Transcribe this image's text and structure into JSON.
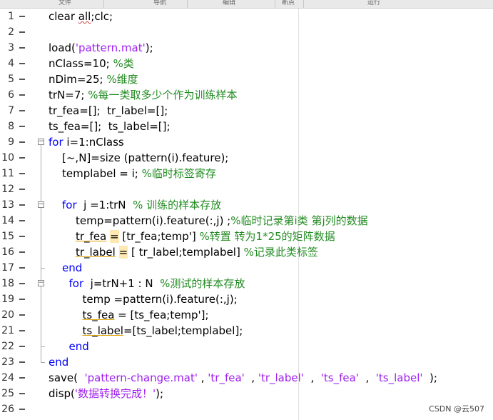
{
  "toolbar": {
    "sections": [
      "文件",
      "导航",
      "编辑",
      "断点",
      "运行"
    ]
  },
  "editor": {
    "lines": [
      {
        "n": "1",
        "indent": 0,
        "tokens": [
          {
            "t": "clear ",
            "c": ""
          },
          {
            "t": "all",
            "c": "squig"
          },
          {
            "t": ";clc;",
            "c": ""
          }
        ]
      },
      {
        "n": "2",
        "indent": 0,
        "tokens": []
      },
      {
        "n": "3",
        "indent": 0,
        "tokens": [
          {
            "t": "load(",
            "c": ""
          },
          {
            "t": "'pattern.mat'",
            "c": "str"
          },
          {
            "t": ");",
            "c": ""
          }
        ]
      },
      {
        "n": "4",
        "indent": 0,
        "tokens": [
          {
            "t": "nClass=10; ",
            "c": ""
          },
          {
            "t": "%类",
            "c": "cm"
          }
        ]
      },
      {
        "n": "5",
        "indent": 0,
        "tokens": [
          {
            "t": "nDim=25; ",
            "c": ""
          },
          {
            "t": "%维度",
            "c": "cm"
          }
        ]
      },
      {
        "n": "6",
        "indent": 0,
        "tokens": [
          {
            "t": "trN=7; ",
            "c": ""
          },
          {
            "t": "%每一类取多少个作为训练样本",
            "c": "cm"
          }
        ]
      },
      {
        "n": "7",
        "indent": 0,
        "tokens": [
          {
            "t": "tr_fea=[];  tr_label=[];",
            "c": ""
          }
        ]
      },
      {
        "n": "8",
        "indent": 0,
        "tokens": [
          {
            "t": "ts_fea=[];  ts_label=[];",
            "c": ""
          }
        ]
      },
      {
        "n": "9",
        "indent": 0,
        "tokens": [
          {
            "t": "for",
            "c": "kw"
          },
          {
            "t": " i=1:nClass",
            "c": ""
          }
        ]
      },
      {
        "n": "10",
        "indent": 1,
        "tokens": [
          {
            "t": "[~,N]=size (pattern(i).feature);",
            "c": ""
          }
        ]
      },
      {
        "n": "11",
        "indent": 1,
        "tokens": [
          {
            "t": "templabel = i; ",
            "c": ""
          },
          {
            "t": "%临时标签寄存",
            "c": "cm"
          }
        ]
      },
      {
        "n": "12",
        "indent": 1,
        "tokens": []
      },
      {
        "n": "13",
        "indent": 1,
        "tokens": [
          {
            "t": "for",
            "c": "kw"
          },
          {
            "t": "  j =1:trN  ",
            "c": ""
          },
          {
            "t": "% 训练的样本存放",
            "c": "cm"
          }
        ]
      },
      {
        "n": "14",
        "indent": 2,
        "tokens": [
          {
            "t": "temp=pattern(i).feature(:,j) ;",
            "c": ""
          },
          {
            "t": "%临时记录第i类 第j列的数据",
            "c": "cm"
          }
        ]
      },
      {
        "n": "15",
        "indent": 2,
        "tokens": [
          {
            "t": "tr_fea",
            "c": "warn"
          },
          {
            "t": " ",
            "c": ""
          },
          {
            "t": "=",
            "c": "hl"
          },
          {
            "t": " [tr_fea;temp'] ",
            "c": ""
          },
          {
            "t": "%转置 转为1*25的矩阵数据",
            "c": "cm"
          }
        ]
      },
      {
        "n": "16",
        "indent": 2,
        "tokens": [
          {
            "t": "tr_label",
            "c": "warn"
          },
          {
            "t": " ",
            "c": ""
          },
          {
            "t": "=",
            "c": "hl"
          },
          {
            "t": " [ tr_label;templabel] ",
            "c": ""
          },
          {
            "t": "%记录此类标签",
            "c": "cm"
          }
        ]
      },
      {
        "n": "17",
        "indent": 1,
        "tokens": [
          {
            "t": "end",
            "c": "kw"
          }
        ]
      },
      {
        "n": "18",
        "indent": 1.5,
        "tokens": [
          {
            "t": "for",
            "c": "kw"
          },
          {
            "t": "  j=trN+1 : N  ",
            "c": ""
          },
          {
            "t": "%测试的样本存放",
            "c": "cm"
          }
        ]
      },
      {
        "n": "19",
        "indent": 2.5,
        "tokens": [
          {
            "t": "temp =pattern(i).feature(:,j);",
            "c": ""
          }
        ]
      },
      {
        "n": "20",
        "indent": 2.5,
        "tokens": [
          {
            "t": "ts_fea",
            "c": "warn"
          },
          {
            "t": " = [ts_fea;temp'];",
            "c": ""
          }
        ]
      },
      {
        "n": "21",
        "indent": 2.5,
        "tokens": [
          {
            "t": "ts_label",
            "c": "warn"
          },
          {
            "t": "=[ts_label;templabel];",
            "c": ""
          }
        ]
      },
      {
        "n": "22",
        "indent": 1.5,
        "tokens": [
          {
            "t": "end",
            "c": "kw"
          }
        ]
      },
      {
        "n": "23",
        "indent": 0,
        "tokens": [
          {
            "t": "end",
            "c": "kw"
          }
        ]
      },
      {
        "n": "24",
        "indent": 0,
        "tokens": [
          {
            "t": "save(  ",
            "c": ""
          },
          {
            "t": "'pattern-change.mat'",
            "c": "str"
          },
          {
            "t": " , ",
            "c": ""
          },
          {
            "t": "'tr_fea'",
            "c": "str"
          },
          {
            "t": "  , ",
            "c": ""
          },
          {
            "t": "'tr_label'",
            "c": "str"
          },
          {
            "t": "  ,  ",
            "c": ""
          },
          {
            "t": "'ts_fea'",
            "c": "str"
          },
          {
            "t": "  ,  ",
            "c": ""
          },
          {
            "t": "'ts_label'",
            "c": "str"
          },
          {
            "t": "  );",
            "c": ""
          }
        ]
      },
      {
        "n": "25",
        "indent": 0,
        "tokens": [
          {
            "t": "disp(",
            "c": ""
          },
          {
            "t": "'数据转换完成！'",
            "c": "str"
          },
          {
            "t": ");",
            "c": ""
          }
        ]
      },
      {
        "n": "26",
        "indent": 0,
        "tokens": []
      }
    ],
    "folds": [
      {
        "start": "9",
        "end": "23"
      },
      {
        "start": "13",
        "end": "17"
      },
      {
        "start": "18",
        "end": "22"
      }
    ]
  },
  "watermark": "CSDN @云507",
  "colors": {
    "keyword": "#0000ff",
    "comment": "#228b22",
    "string": "#a020f0"
  }
}
